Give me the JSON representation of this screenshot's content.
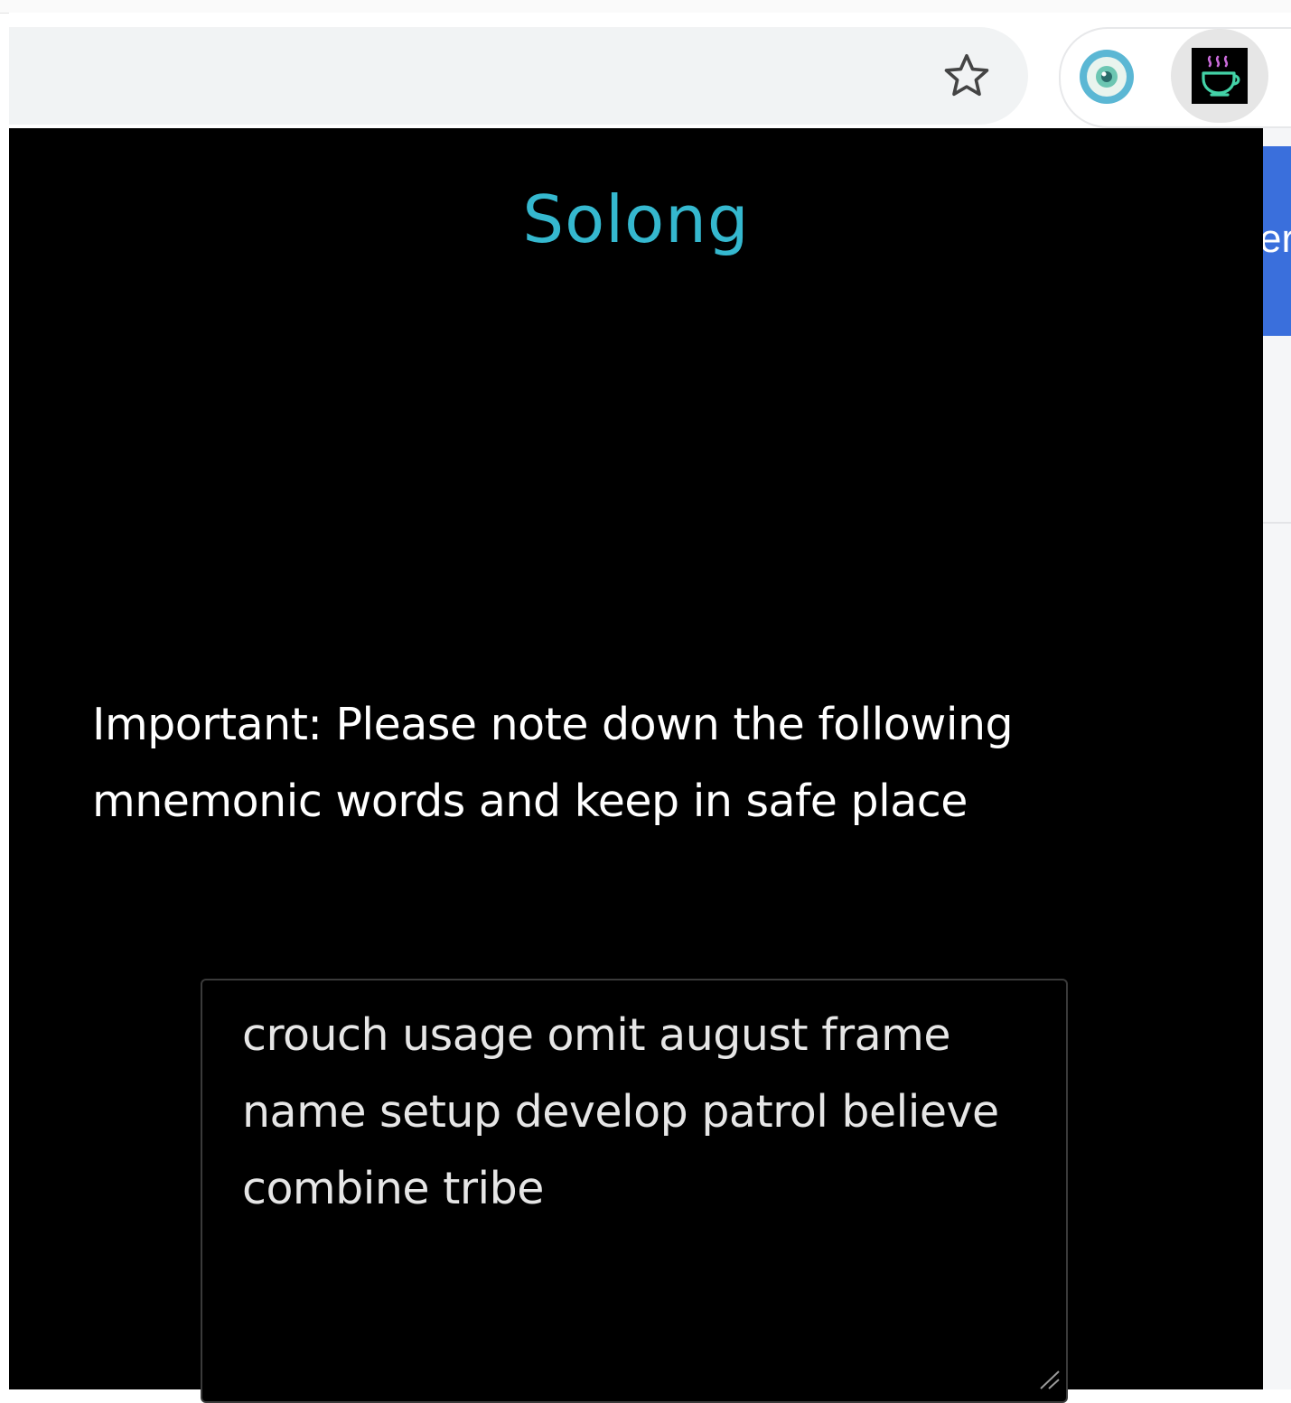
{
  "browser": {
    "toolbar_icons": [
      "star-icon",
      "eye-extension-icon",
      "solong-extension-icon"
    ],
    "behind_page_fragment": "er"
  },
  "popup": {
    "title": "Solong",
    "warning": "Important: Please note down the following mnemonic words and keep in safe place",
    "mnemonic": "crouch usage omit august frame name setup develop patrol believe combine tribe"
  },
  "colors": {
    "title": "#35b8cf",
    "popup_background": "#000000",
    "text": "#ffffff",
    "behind_page_accent": "#3a6fdc"
  }
}
